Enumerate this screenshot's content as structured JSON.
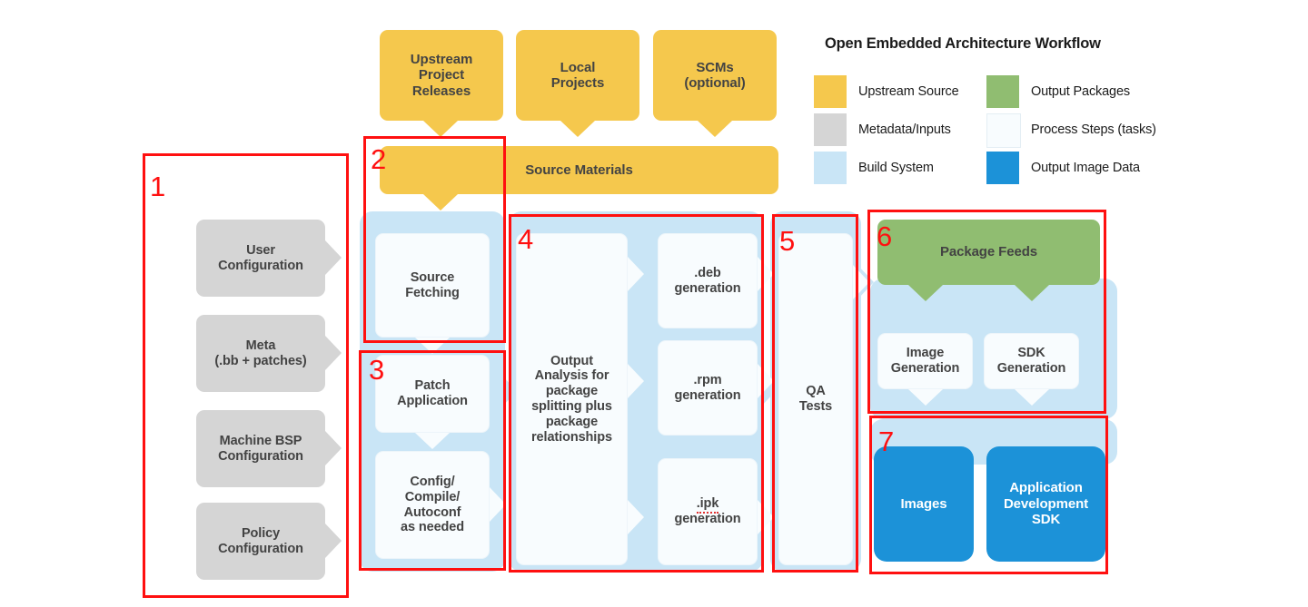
{
  "diagram": {
    "title": "Open Embedded Architecture Workflow"
  },
  "legend": {
    "title": "Open Embedded Architecture Workflow",
    "items": [
      {
        "label": "Upstream Source",
        "color": "#F5C84D"
      },
      {
        "label": "Metadata/Inputs",
        "color": "#D5D5D5"
      },
      {
        "label": "Build System",
        "color": "#C9E5F6"
      },
      {
        "label": "Output Packages",
        "color": "#90BD71"
      },
      {
        "label": "Process Steps (tasks)",
        "color": "#F8FCFE"
      },
      {
        "label": "Output Image Data",
        "color": "#1C92D8"
      }
    ]
  },
  "regions": [
    {
      "number": "1",
      "name": "user-configuration-inputs"
    },
    {
      "number": "2",
      "name": "source-fetching"
    },
    {
      "number": "3",
      "name": "patch-and-build"
    },
    {
      "number": "4",
      "name": "package-splitting-and-generation"
    },
    {
      "number": "5",
      "name": "qa-tests"
    },
    {
      "number": "6",
      "name": "package-feeds-and-generation"
    },
    {
      "number": "7",
      "name": "output-image-data"
    }
  ],
  "sources": {
    "upstream_project_releases": "Upstream\nProject\nReleases",
    "local_projects": "Local\nProjects",
    "scms": "SCMs\n(optional)",
    "source_materials": "Source Materials"
  },
  "inputs": {
    "user_configuration": "User\nConfiguration",
    "meta": "Meta\n(.bb + patches)",
    "machine_bsp_configuration": "Machine BSP\nConfiguration",
    "policy_configuration": "Policy\nConfiguration"
  },
  "tasks": {
    "source_fetching": "Source\nFetching",
    "patch_application": "Patch\nApplication",
    "config_compile": "Config/\nCompile/\nAutoconf\nas needed",
    "output_analysis": "Output\nAnalysis for\npackage\nsplitting plus\npackage\nrelationships",
    "deb_generation_ext": ".deb",
    "deb_generation_word": "generation",
    "rpm_generation_ext": ".rpm",
    "rpm_generation_word": "generation",
    "ipk_generation_ext": ".ipk",
    "ipk_generation_word": "generation",
    "qa_tests": "QA\nTests",
    "image_generation": "Image\nGeneration",
    "sdk_generation": "SDK\nGeneration"
  },
  "outputs": {
    "package_feeds": "Package Feeds",
    "images": "Images",
    "application_development_sdk": "Application\nDevelopment\nSDK"
  }
}
